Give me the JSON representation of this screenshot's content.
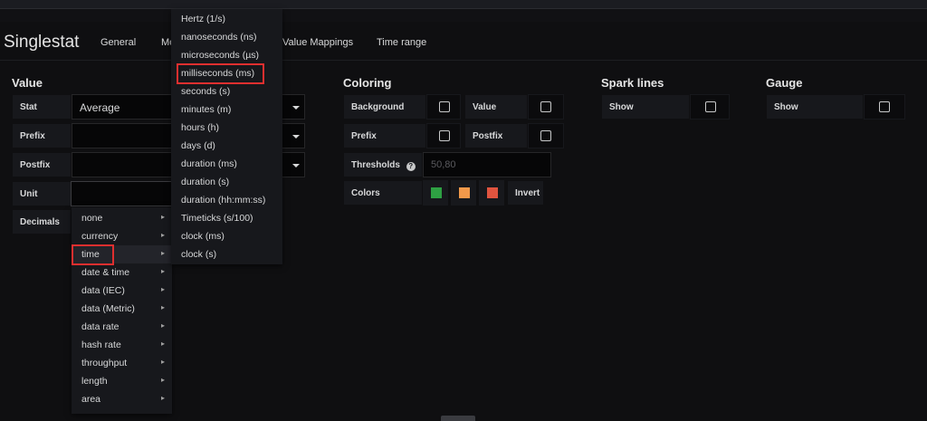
{
  "panel_title": "Singlestat",
  "tabs": [
    "General",
    "Me",
    "Value Mappings",
    "Time range"
  ],
  "value": {
    "title": "Value",
    "stat_label": "Stat",
    "stat_value": "Average",
    "prefix_label": "Prefix",
    "postfix_label": "Postfix",
    "unit_label": "Unit",
    "decimals_label": "Decimals"
  },
  "coloring": {
    "title": "Coloring",
    "background_label": "Background",
    "value_label": "Value",
    "prefix_label": "Prefix",
    "postfix_label": "Postfix",
    "thresholds_label": "Thresholds",
    "thresholds_icon": "help-circle-icon",
    "thresholds_placeholder": "50,80",
    "colors_label": "Colors",
    "colors": [
      "#2ea043",
      "#f2994a",
      "#e0543f"
    ],
    "invert_label": "Invert"
  },
  "spark_lines": {
    "title": "Spark lines",
    "show_label": "Show"
  },
  "gauge": {
    "title": "Gauge",
    "show_label": "Show"
  },
  "unit_categories": {
    "items": [
      "none",
      "currency",
      "time",
      "date & time",
      "data (IEC)",
      "data (Metric)",
      "data rate",
      "hash rate",
      "throughput",
      "length",
      "area"
    ],
    "highlighted": "time"
  },
  "time_units": {
    "items": [
      "Hertz (1/s)",
      "nanoseconds (ns)",
      "microseconds (µs)",
      "milliseconds (ms)",
      "seconds (s)",
      "minutes (m)",
      "hours (h)",
      "days (d)",
      "duration (ms)",
      "duration (s)",
      "duration (hh:mm:ss)",
      "Timeticks (s/100)",
      "clock (ms)",
      "clock (s)"
    ],
    "highlighted": "milliseconds (ms)"
  },
  "highlight_color": "#e02f2f"
}
